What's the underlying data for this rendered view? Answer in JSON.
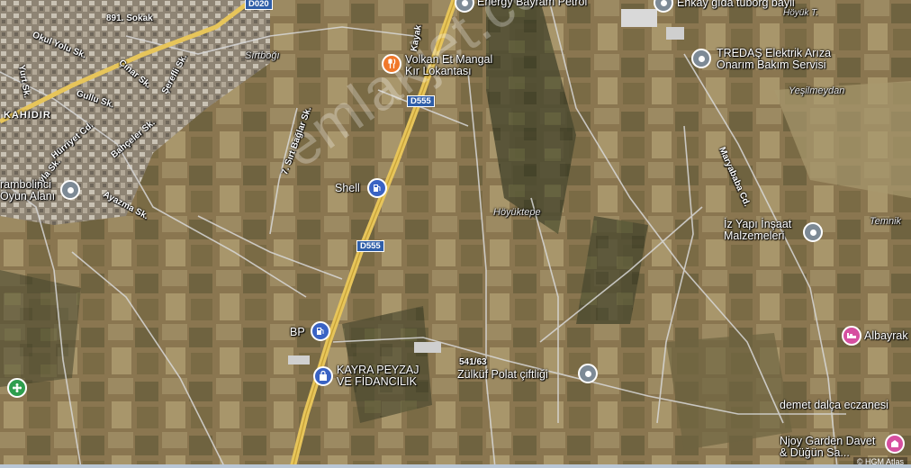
{
  "colors": {
    "road_major": "#e7c55a",
    "poi_grey": "#7d8a96",
    "poi_orange": "#f0782a",
    "poi_blue": "#3a63c4",
    "poi_pink": "#d64fa0",
    "poi_green": "#2e9e4e"
  },
  "road_shields": {
    "d555_top": "D555",
    "d555_mid": "D555",
    "d020": "D020"
  },
  "streets": {
    "okul_yolu": "Okul Yolu Sk.",
    "yurt": "Yurt Sk.",
    "cinar": "Çınar Sk.",
    "gullu": "Gullu Sk.",
    "serefli": "Şerefli Sk.",
    "huriyet": "Hürriyet Cd.",
    "bahceler": "Bahçeler Sk.",
    "yayla": "Yayla Sk.",
    "ayazma": "Ayazma Sk.",
    "sirt_baglar": "7. Sırt Bağlar Sk.",
    "maryababa": "Maryababa Cd.",
    "kayak": "Kayak",
    "sk891": "891. Sokak",
    "kahidir": "KAHIDIR"
  },
  "places": {
    "sirtbogi": "Sırtboğı",
    "yesilmeydan": "Yeşilmeydan",
    "hoyuktepe": "Höyüktepe",
    "temnik": "Temnik",
    "hoyuk": "Höyük T."
  },
  "pois": {
    "energy": "Energy Bayram Petrol",
    "enkay": "Enkay gıda tuborg bayii",
    "volkan_line1": "Volkan Et Mangal",
    "volkan_line2": "Kır Lokantası",
    "tredas_line1": "TREDAŞ Elektrik Arıza",
    "tredas_line2": "Onarım Bakım Servisi",
    "shell": "Shell",
    "oyun_line1": "rambolinci",
    "oyun_line2": "Oyun Alanı",
    "iz_line1": "İz Yapı İnşaat",
    "iz_line2": "Malzemeleri",
    "bp": "BP",
    "kayra_line1": "KAYRA PEYZAJ",
    "kayra_line2": "VE FİDANCILIK",
    "zulkuf": "Zülküf Polat çiftliği",
    "albayrak": "Albayrak",
    "demet": "demet dalça eczanesi",
    "njoy_line1": "Njoy Garden Davet",
    "njoy_line2": "& Düğün Sa..."
  },
  "parcel_label": "541/63",
  "watermark": "emlakjet.com",
  "attribution": "© HGM Atlas"
}
